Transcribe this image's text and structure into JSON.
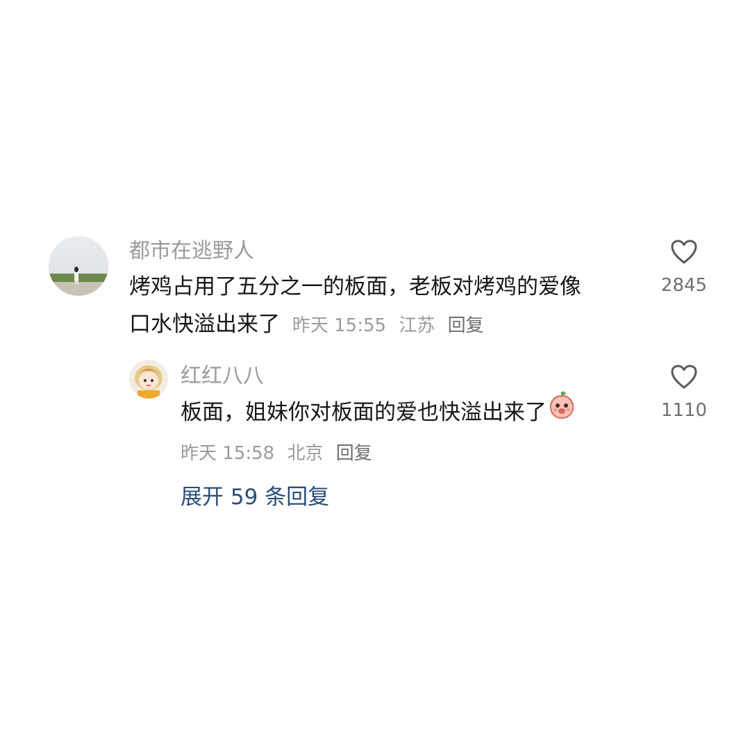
{
  "comment": {
    "username": "都市在逃野人",
    "text_line1": "烤鸡占用了五分之一的板面，老板对烤鸡的爱像",
    "text_line2": "口水快溢出来了",
    "time": "昨天 15:55",
    "location": "江苏",
    "reply_label": "回复",
    "like_count": "2845",
    "like_icon": "heart-outline-icon"
  },
  "reply": {
    "username": "红红八八",
    "text": "板面，姐妹你对板面的爱也快溢出来了",
    "emoji_icon": "peach-emoji-icon",
    "time": "昨天 15:58",
    "location": "北京",
    "reply_label": "回复",
    "like_count": "1110",
    "like_icon": "heart-outline-icon"
  },
  "expand_label": "展开 59 条回复",
  "colors": {
    "text": "#161616",
    "secondary": "#9a9a9a",
    "link": "#2a4c79"
  }
}
